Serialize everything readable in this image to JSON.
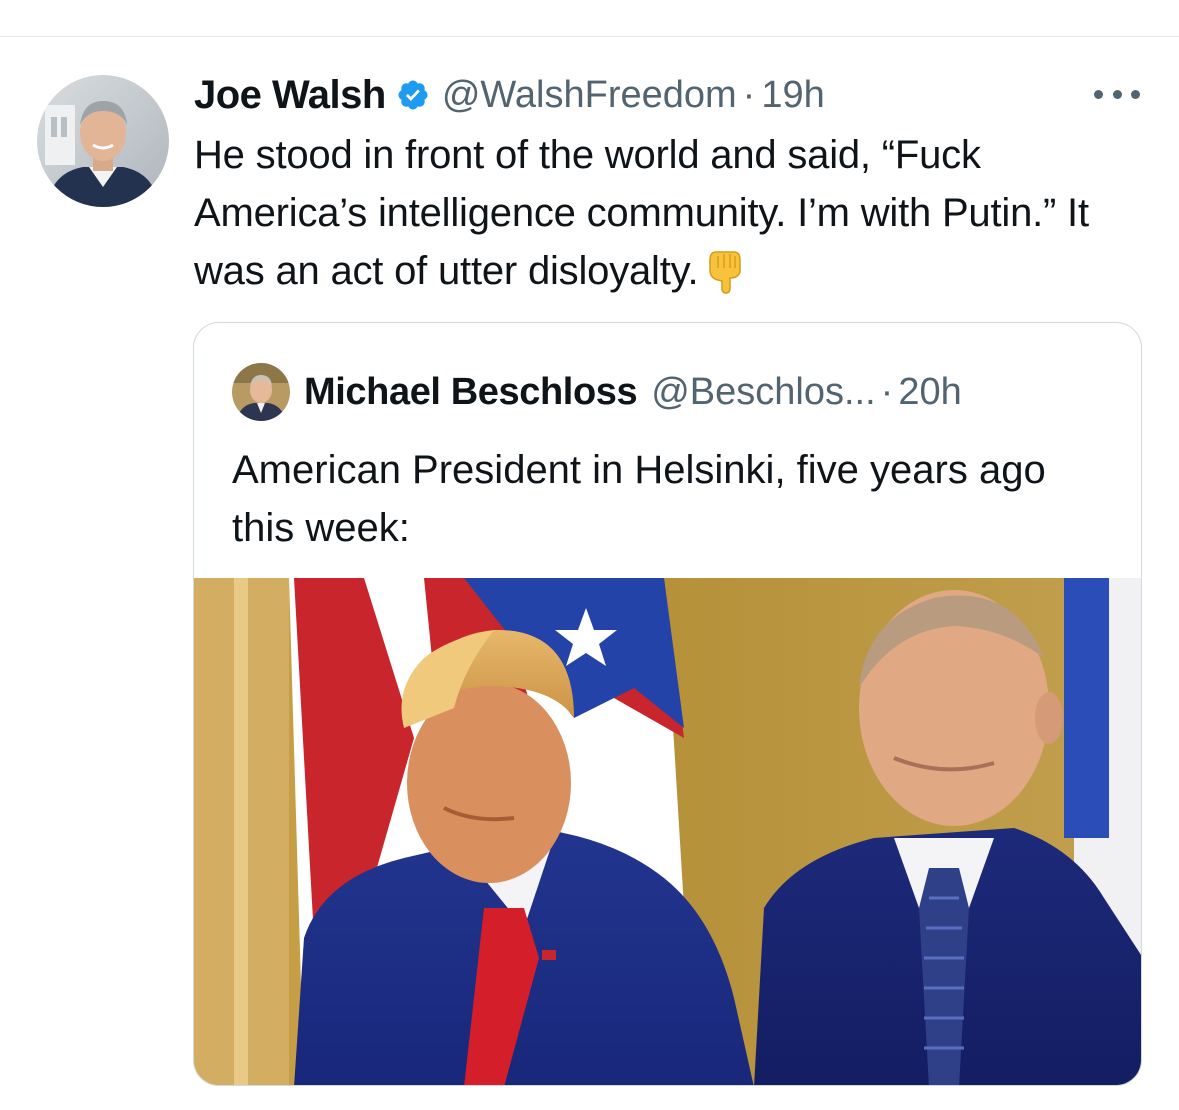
{
  "tweet": {
    "author": {
      "display_name": "Joe Walsh",
      "handle": "@WalshFreedom",
      "verified": true,
      "verified_icon": "verified-badge-icon",
      "verified_color": "#1d9bf0"
    },
    "separator": "·",
    "time": "19h",
    "more_icon": "more-dots-icon",
    "text": "He stood in front of the world and said, “Fuck America’s intelligence community. I’m with Putin.” It was an act of utter disloyalty.",
    "emoji": "backhand-index-pointing-down-emoji",
    "quoted_tweet": {
      "author": {
        "display_name": "Michael Beschloss",
        "handle": "@Beschlos..."
      },
      "separator": "·",
      "time": "20h",
      "text": "American President in Helsinki, five years ago this week:",
      "media": {
        "kind": "photo"
      }
    }
  },
  "colors": {
    "text_primary": "#0f1419",
    "text_secondary": "#536471",
    "border": "#cfd9de",
    "verified": "#1d9bf0"
  }
}
